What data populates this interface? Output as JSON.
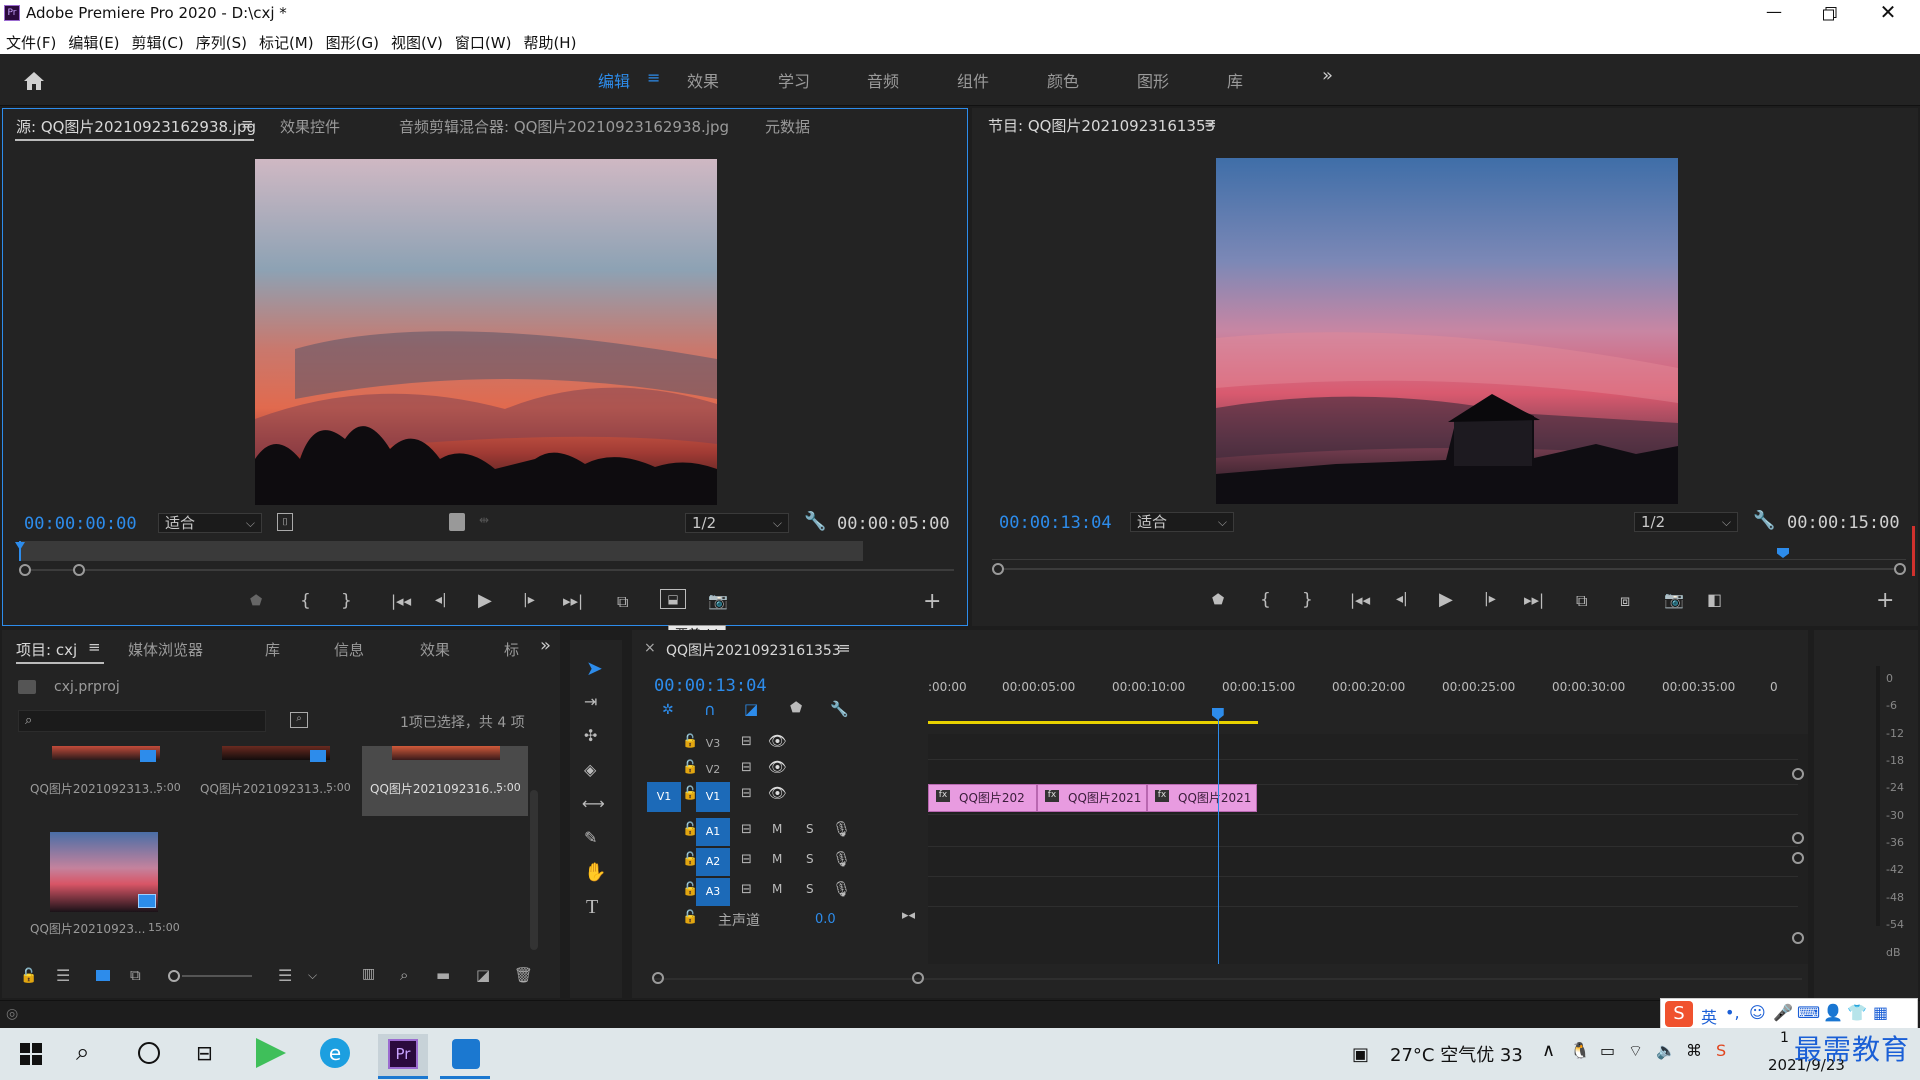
{
  "window": {
    "title": "Adobe Premiere Pro 2020 - D:\\cxj *",
    "app_badge": "Pr"
  },
  "menu": [
    "文件(F)",
    "编辑(E)",
    "剪辑(C)",
    "序列(S)",
    "标记(M)",
    "图形(G)",
    "视图(V)",
    "窗口(W)",
    "帮助(H)"
  ],
  "workspaces": {
    "active": "编辑",
    "tabs": [
      "效果",
      "学习",
      "音频",
      "组件",
      "颜色",
      "图形",
      "库"
    ]
  },
  "source_panel": {
    "tab_source": "源: QQ图片20210923162938.jpg",
    "tab_effect_controls": "效果控件",
    "tab_audio_mixer": "音频剪辑混合器: QQ图片20210923162938.jpg",
    "tab_metadata": "元数据",
    "timecode": "00:00:00:00",
    "fit": "适合",
    "resolution": "1/2",
    "duration": "00:00:05:00",
    "tooltip": "覆盖 (.)"
  },
  "program_panel": {
    "tab": "节目: QQ图片20210923161353",
    "timecode": "00:00:13:04",
    "fit": "适合",
    "resolution": "1/2",
    "duration": "00:00:15:00"
  },
  "project_panel": {
    "tab_project": "项目: cxj",
    "tab_media_browser": "媒体浏览器",
    "tab_library": "库",
    "tab_info": "信息",
    "tab_effects": "效果",
    "tab_more": "标",
    "file": "cxj.prproj",
    "selection": "1项已选择，共 4 项",
    "items": [
      {
        "name": "QQ图片2021092313...",
        "duration": "5:00"
      },
      {
        "name": "QQ图片2021092313...",
        "duration": "5:00"
      },
      {
        "name": "QQ图片2021092316...",
        "duration": "5:00"
      },
      {
        "name": "QQ图片20210923...",
        "duration": "15:00"
      }
    ]
  },
  "timeline": {
    "tab": "QQ图片20210923161353",
    "timecode": "00:00:13:04",
    "ruler": [
      ":00:00",
      "00:00:05:00",
      "00:00:10:00",
      "00:00:15:00",
      "00:00:20:00",
      "00:00:25:00",
      "00:00:30:00",
      "00:00:35:00",
      "0"
    ],
    "tracks": {
      "v3": "V3",
      "v2": "V2",
      "v1_src": "V1",
      "v1": "V1",
      "a1": "A1",
      "a2": "A2",
      "a3": "A3",
      "m": "M",
      "s": "S"
    },
    "master": {
      "label": "主声道",
      "value": "0.0"
    },
    "clips": [
      "QQ图片202",
      "QQ图片2021",
      "QQ图片2021"
    ],
    "playhead_seconds": 13.17,
    "work_area_end_seconds": 15
  },
  "meter": {
    "labels": [
      "0",
      "-6",
      "-12",
      "-18",
      "-24",
      "-30",
      "-36",
      "-42",
      "-48",
      "-54",
      "dB"
    ]
  },
  "ime": {
    "lang": "英"
  },
  "taskbar": {
    "weather": "27°C 空气优 33",
    "time": "1",
    "date": "2021/9/23",
    "watermark": "最需教育"
  },
  "colors": {
    "accent": "#2d8ceb",
    "clip": "#e89be0",
    "work_area": "#e8d200",
    "pr_badge": "#2b0a3d"
  }
}
